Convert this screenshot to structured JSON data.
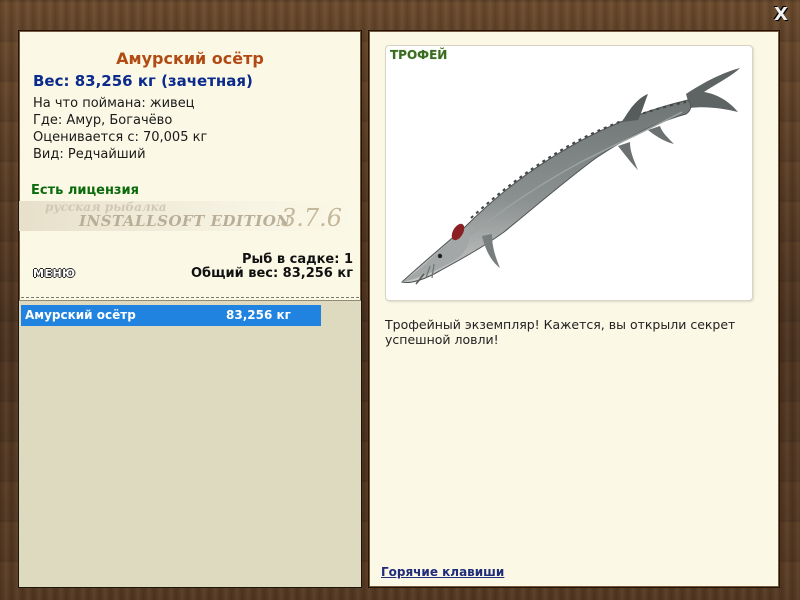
{
  "window": {
    "close_label": "X"
  },
  "catch": {
    "name": "Амурский осётр",
    "weight_line": "Вес: 83,256 кг (зачетная)",
    "bait_line": "На что поймана: живец",
    "location_line": "Где: Амур, Богачёво",
    "scored_from_line": "Оценивается с: 70,005 кг",
    "rarity_line": "Вид: Редчайший",
    "license_text": "Есть лицензия"
  },
  "logo": {
    "top_text": "русская рыбалка",
    "main_text": "INSTALLSOFT EDITION",
    "version": "3.7.6"
  },
  "keepnet": {
    "count_line": "Рыб в садке: 1",
    "total_weight_line": "Общий вес: 83,256 кг"
  },
  "menu": {
    "label": "МЕНЮ"
  },
  "fish_list": [
    {
      "name": "Амурский осётр",
      "weight": "83,256 кг",
      "selected": true
    }
  ],
  "trophy": {
    "label": "ТРОФЕЙ",
    "image_icon": "sturgeon-image",
    "description": "Трофейный экземпляр! Кажется, вы открыли секрет успешной ловли!"
  },
  "hotkeys": {
    "label": "Горячие клавиши"
  },
  "colors": {
    "title": "#b14a13",
    "weight": "#0a2a8c",
    "license": "#0b6a0b",
    "selection": "#1f83df",
    "panel_bg": "#fbf8e6",
    "list_bg": "#dddac0"
  }
}
